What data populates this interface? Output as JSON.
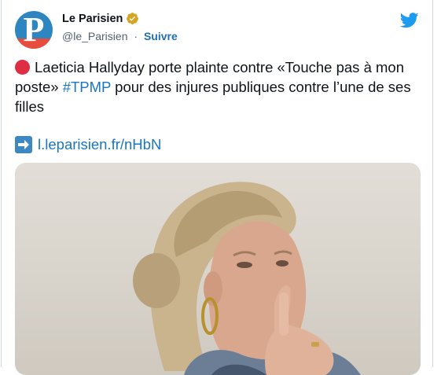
{
  "account": {
    "name": "Le Parisien",
    "handle": "@le_Parisien",
    "separator": "·",
    "follow_label": "Suivre",
    "avatar_letter": "P"
  },
  "tweet": {
    "text_before_hashtag": "Laeticia Hallyday porte plainte contre «Touche pas à mon poste» ",
    "hashtag": "#TPMP",
    "text_after_hashtag": " pour des injures publiques contre l’une de ses filles",
    "link": "l.leparisien.fr/nHbN"
  },
  "icons": {
    "verified": "verified-badge-icon",
    "platform": "twitter-bird-icon",
    "emoji_red_circle": "red-circle-icon",
    "emoji_arrow": "right-arrow-icon"
  },
  "colors": {
    "link": "#1b76c0",
    "verified_badge": "#d4a520",
    "bird": "#1d9bf0"
  }
}
